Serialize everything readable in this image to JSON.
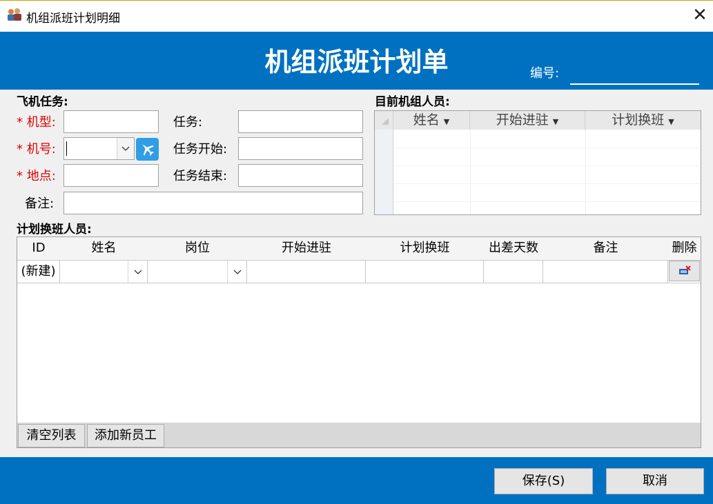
{
  "window": {
    "title": "机组派班计划明细",
    "close_glyph": "✕"
  },
  "header": {
    "title": "机组派班计划单",
    "code_label": "编号:"
  },
  "task_section": {
    "label": "飞机任务:",
    "aircraft_type": {
      "star": "*",
      "label": "机型:",
      "value": ""
    },
    "aircraft_no": {
      "star": "*",
      "label": "机号:",
      "value": ""
    },
    "location": {
      "star": "*",
      "label": "地点:",
      "value": ""
    },
    "task": {
      "label": "任务:",
      "value": ""
    },
    "task_start": {
      "label": "任务开始:",
      "value": ""
    },
    "task_end": {
      "label": "任务结束:",
      "value": ""
    },
    "remark": {
      "label": "备注:",
      "value": ""
    }
  },
  "current_crew": {
    "label": "目前机组人员:",
    "columns": [
      "姓名",
      "开始进驻",
      "计划换班"
    ]
  },
  "shift_section": {
    "label": "计划换班人员:",
    "columns": [
      "ID",
      "姓名",
      "岗位",
      "开始进驻",
      "计划换班",
      "出差天数",
      "备注",
      "删除"
    ],
    "new_row_id": "(新建)",
    "clear_button": "清空列表",
    "add_button": "添加新员工"
  },
  "footer": {
    "save_label": "保存(S)",
    "cancel_label": "取消"
  },
  "icons": {
    "app": "app-crew-icon",
    "plane": "airplane-icon",
    "delete": "delete-row-icon",
    "dropdown": "chevron-down-icon"
  },
  "colors": {
    "accent": "#0071c0",
    "required": "#e00000",
    "plane_button": "#2f9ee6"
  }
}
